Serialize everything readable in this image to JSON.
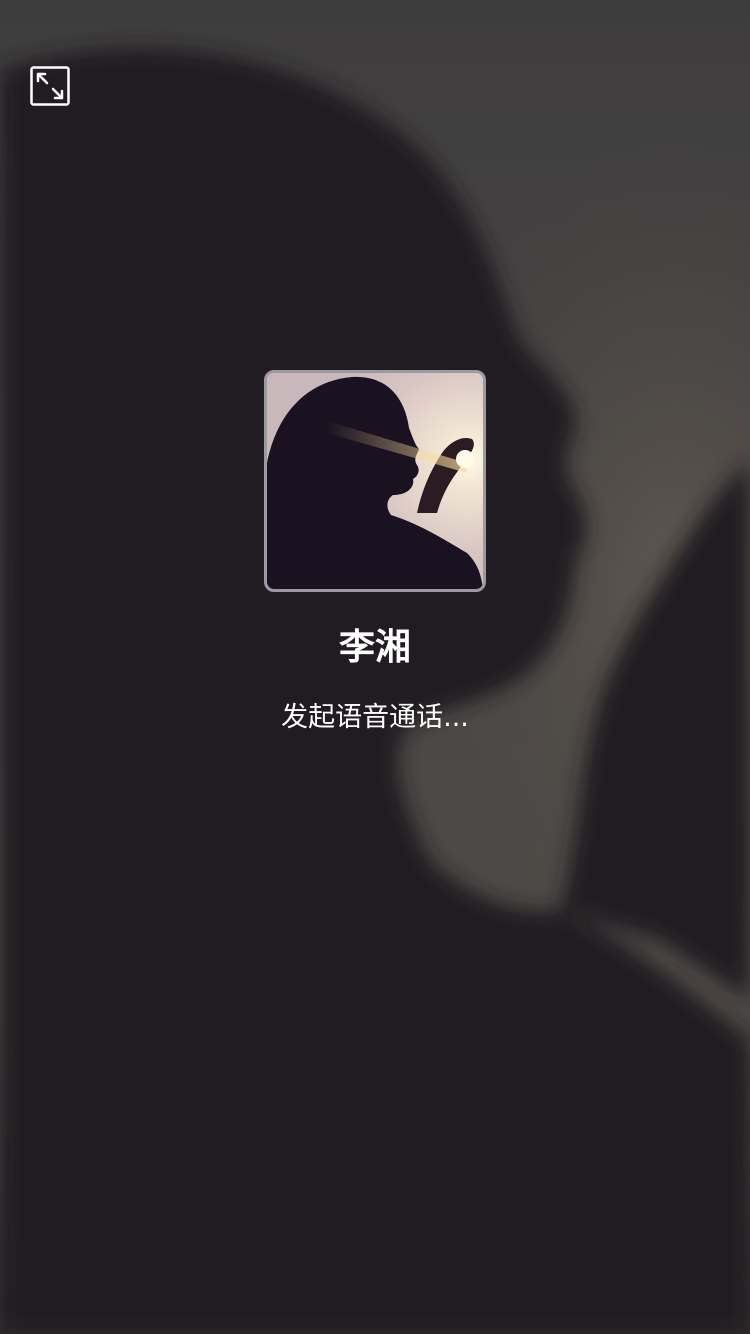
{
  "call": {
    "caller_name": "李湘",
    "status_text": "发起语音通话..."
  },
  "icons": {
    "minimize": "minimize-window-icon",
    "avatar": "caller-avatar"
  },
  "colors": {
    "background": "#211f22",
    "text": "#ffffff",
    "avatar_border": "#9b9aa0"
  }
}
